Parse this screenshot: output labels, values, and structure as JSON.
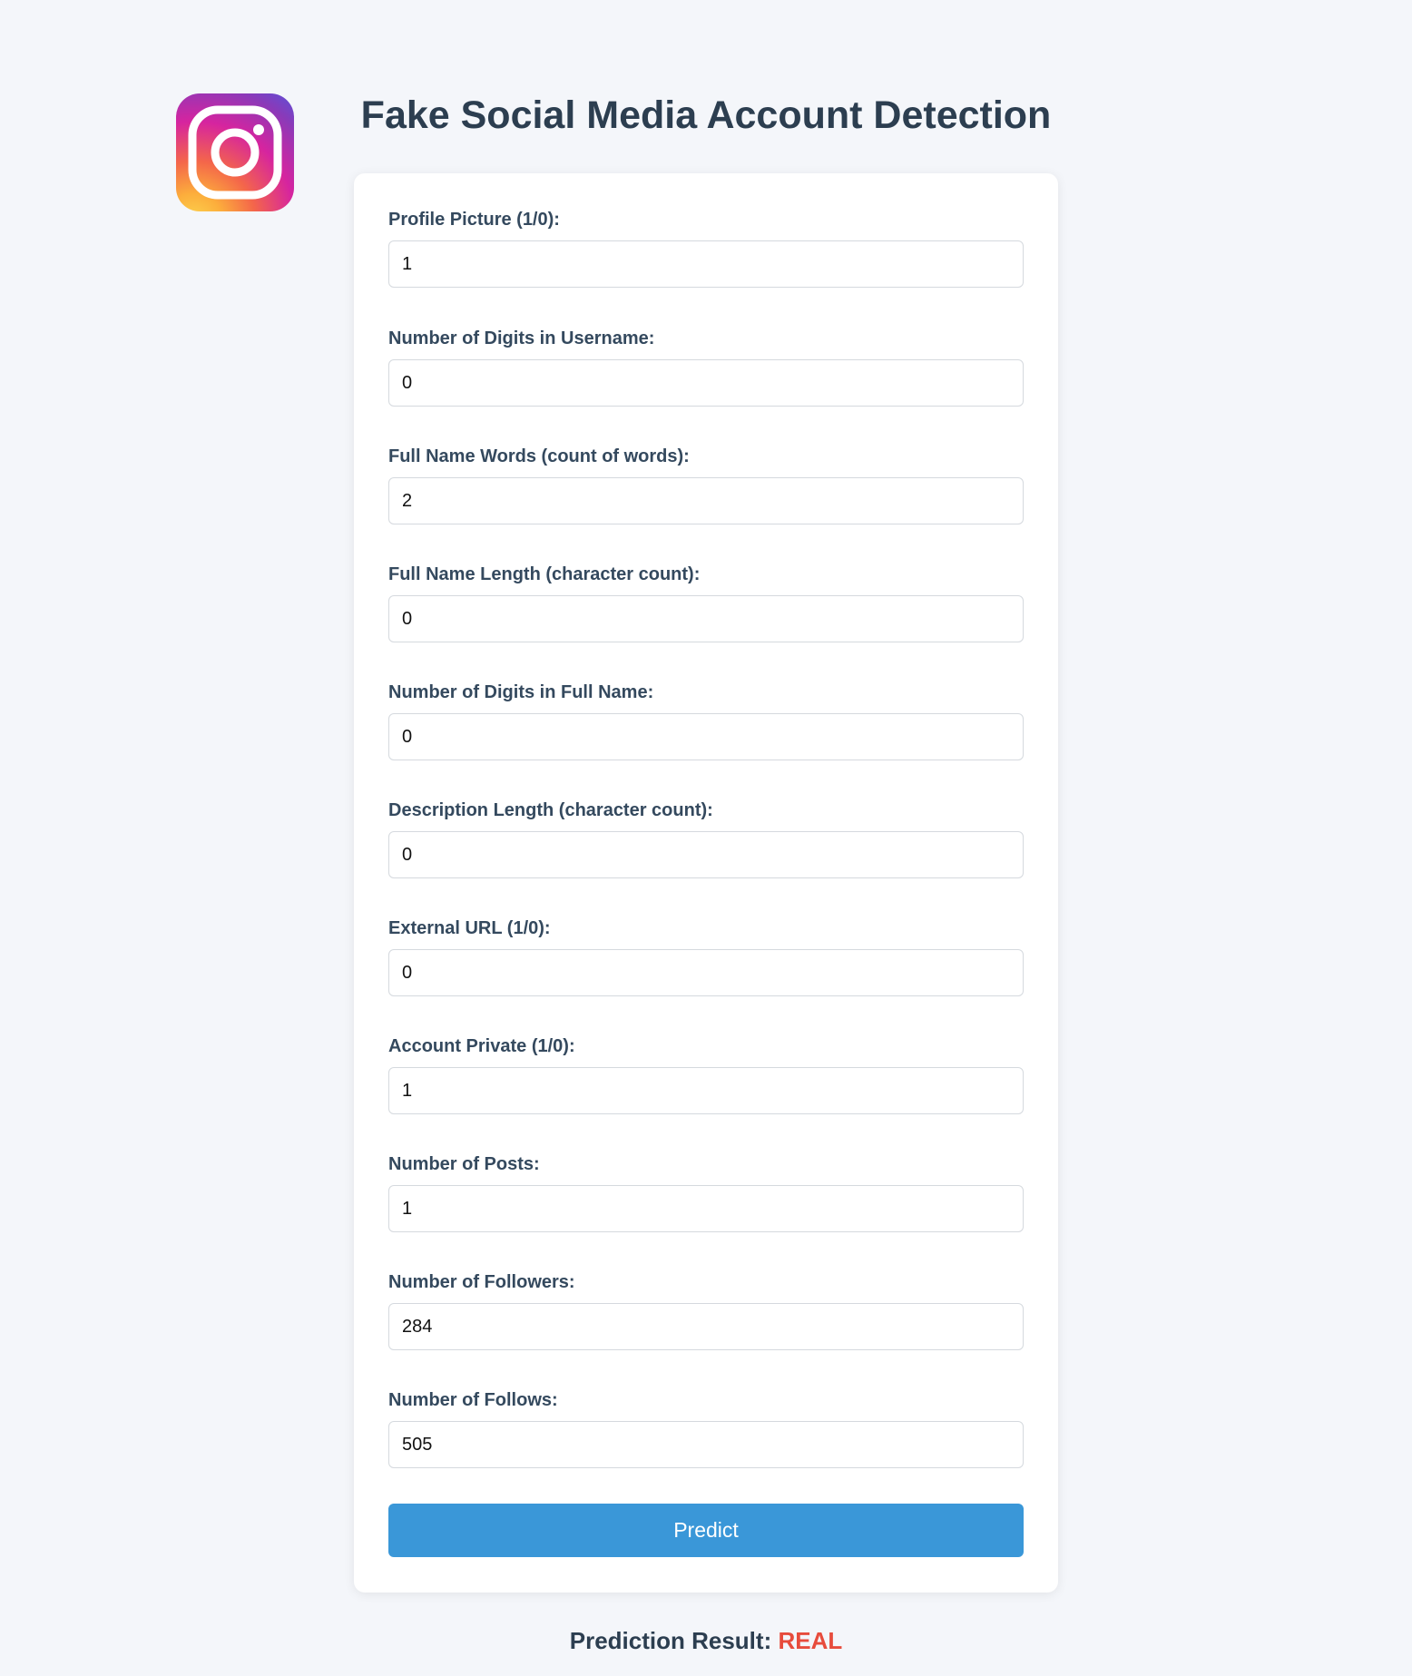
{
  "header": {
    "title": "Fake Social Media Account Detection",
    "logo_icon": "instagram-logo-icon"
  },
  "form": {
    "fields": [
      {
        "label": "Profile Picture (1/0):",
        "value": "1"
      },
      {
        "label": "Number of Digits in Username:",
        "value": "0"
      },
      {
        "label": "Full Name Words (count of words):",
        "value": "2"
      },
      {
        "label": "Full Name Length (character count):",
        "value": "0"
      },
      {
        "label": "Number of Digits in Full Name:",
        "value": "0"
      },
      {
        "label": "Description Length (character count):",
        "value": "0"
      },
      {
        "label": "External URL (1/0):",
        "value": "0"
      },
      {
        "label": "Account Private (1/0):",
        "value": "1"
      },
      {
        "label": "Number of Posts:",
        "value": "1"
      },
      {
        "label": "Number of Followers:",
        "value": "284"
      },
      {
        "label": "Number of Follows:",
        "value": "505"
      }
    ],
    "submit_label": "Predict"
  },
  "result": {
    "label": "Prediction Result:",
    "value": "REAL"
  },
  "colors": {
    "background": "#f4f6fa",
    "title": "#2c3e50",
    "button": "#3a97d8",
    "result_value": "#e74c3c"
  }
}
